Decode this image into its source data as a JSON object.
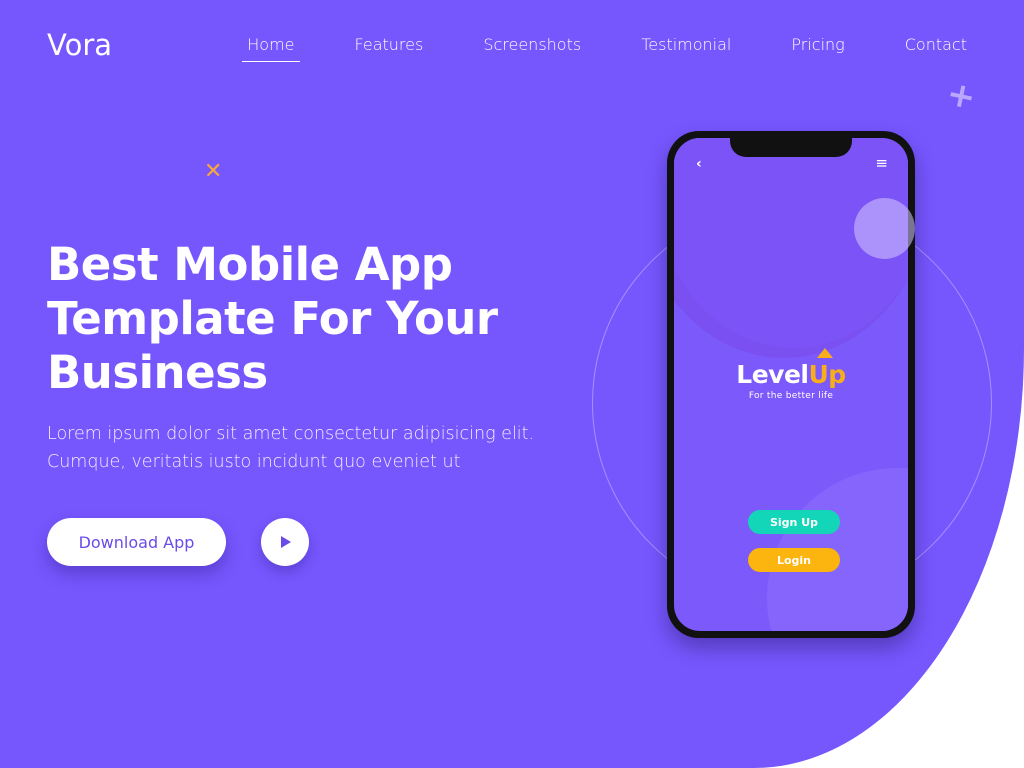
{
  "brand": {
    "logo": "Vora"
  },
  "nav": {
    "items": [
      {
        "label": "Home",
        "active": true
      },
      {
        "label": "Features"
      },
      {
        "label": "Screenshots"
      },
      {
        "label": "Testimonial"
      },
      {
        "label": "Pricing"
      },
      {
        "label": "Contact"
      }
    ]
  },
  "hero": {
    "headline": "Best Mobile App Template For Your Business",
    "subtitle": "Lorem ipsum dolor sit amet consectetur adipisicing elit. Cumque, veritatis iusto incidunt quo eveniet ut",
    "download_label": "Download App"
  },
  "phone": {
    "app_name_part1": "Level",
    "app_name_part2": "Up",
    "tagline": "For the better life",
    "signup_label": "Sign Up",
    "login_label": "Login",
    "back_glyph": "‹",
    "menu_glyph": "≡"
  },
  "icons": {
    "decor_cross": "cross-icon",
    "decor_plus": "plus-icon",
    "play": "play-icon"
  },
  "colors": {
    "hero_bg": "#7657fe",
    "accent_orange": "#f8ae1a",
    "accent_teal": "#13d6b8"
  }
}
